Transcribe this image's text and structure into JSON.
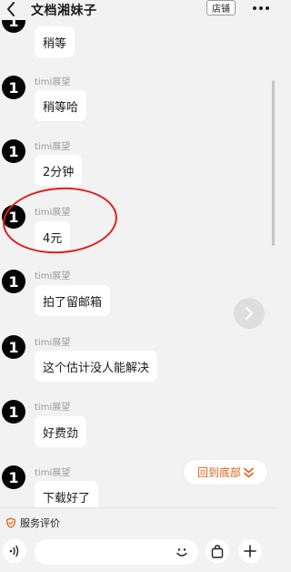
{
  "header": {
    "title": "文档湘妹子",
    "shop_label": "店铺"
  },
  "messages": [
    {
      "sender": "",
      "text": "稍等"
    },
    {
      "sender": "timi展望",
      "text": "稍等哈"
    },
    {
      "sender": "timi展望",
      "text": "2分钟"
    },
    {
      "sender": "timi展望",
      "text": "4元"
    },
    {
      "sender": "timi展望",
      "text": "拍了留邮箱"
    },
    {
      "sender": "timi展望",
      "text": "这个估计没人能解决"
    },
    {
      "sender": "timi展望",
      "text": "好费劲"
    },
    {
      "sender": "timi展望",
      "text": "下载好了"
    }
  ],
  "avatar_label": "1",
  "scroll_bottom_label": "回到底部",
  "footer": {
    "service_rating_label": "服务评价",
    "input_placeholder": ""
  },
  "colors": {
    "accent_orange": "#e0611b",
    "annotation_red": "#e01e1e",
    "background": "#f2f2f2"
  }
}
